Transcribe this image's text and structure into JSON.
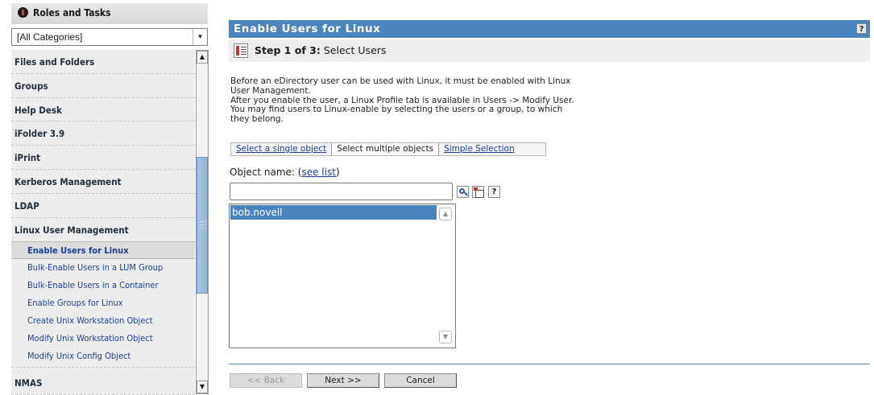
{
  "sidebar": {
    "header": "Roles and Tasks",
    "category_select": "[All Categories]",
    "categories": [
      "Files and Folders",
      "Groups",
      "Help Desk",
      "iFolder 3.9",
      "iPrint",
      "Kerberos Management",
      "LDAP",
      "Linux User Management"
    ],
    "tasks": [
      "Enable Users for Linux",
      "Bulk-Enable Users in a LUM Group",
      "Bulk-Enable Users in a Container",
      "Enable Groups for Linux",
      "Create Unix Workstation Object",
      "Modify Unix Workstation Object",
      "Modify Unix Config Object"
    ],
    "after_category": "NMAS"
  },
  "main": {
    "title": "Enable Users for Linux",
    "help": "?",
    "step_label": "Step 1 of 3:",
    "step_text": "Select Users",
    "description": [
      "Before an eDirectory user can be used with Linux, it must be enabled with Linux",
      "User Management.",
      "After you enable the user, a Linux Profile tab is available in Users -> Modify User.",
      "You may find users to Linux-enable by selecting the users or a group, to which",
      "they belong."
    ],
    "tabs": [
      "Select a single object",
      "Select multiple objects",
      "Simple Selection"
    ],
    "object_name_label": "Object name: (",
    "see_list": "see list",
    "object_name_close": ")",
    "object_input_value": "",
    "selected_objects": [
      "bob.novell"
    ],
    "buttons": {
      "back": "<< Back",
      "next": "Next >>",
      "cancel": "Cancel"
    }
  }
}
